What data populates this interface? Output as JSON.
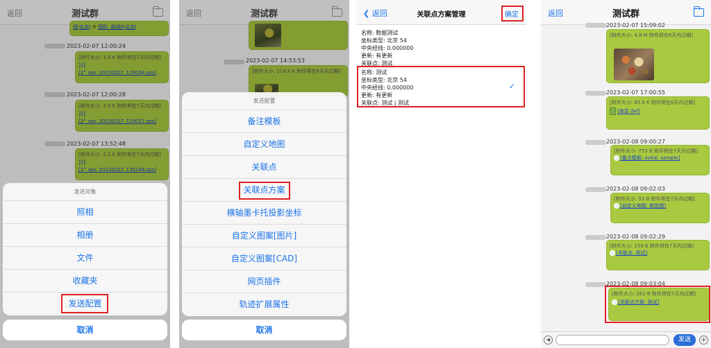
{
  "p1": {
    "nav": {
      "back": "返回",
      "title": "测试群"
    },
    "msg0": {
      "link": "线|北京|"
    },
    "msg0b": {
      "link": "图形: 路线6|北京|"
    },
    "msg1": {
      "time": "2023-02-07 12:00:24",
      "info": "[附件大小: 3.9 K 附件将在7天内过期]",
      "link": "[2°_sps_20230207_120024.sps]"
    },
    "msg2": {
      "time": "2023-02-07 12:00:28",
      "info": "[附件大小: 3.9 K 附件将在7天内过期]",
      "link": "[2°_sps_20230207_120027.sps]"
    },
    "msg3": {
      "time": "2023-02-07 13:52:48",
      "info": "[附件大小: 2.2 K 附件将在7天内过期]",
      "link": "[1°_sps_20230207_135248.sps]"
    },
    "sheet": {
      "header": "发送对象",
      "items": [
        "照相",
        "相册",
        "文件",
        "收藏夹",
        "发送配置"
      ],
      "cancel": "取消"
    }
  },
  "p2": {
    "nav": {
      "back": "返回",
      "title": "测试群"
    },
    "msg1": {
      "time": "2023-02-07 14:53:53",
      "info": "[附件大小: 214.8 K 附件将在6天内过期]"
    },
    "sheet": {
      "header": "发送配置",
      "items": [
        "备注模板",
        "自定义地图",
        "关联点",
        "关联点方案",
        "横轴墨卡托投影坐标",
        "自定义图案[图片]",
        "自定义图案[CAD]",
        "网页插件",
        "轨迹扩展属性"
      ],
      "cancel": "取消"
    }
  },
  "p3": {
    "nav": {
      "back": "返回",
      "title": "关联点方案管理",
      "confirm": "确定"
    },
    "scheme1": [
      "名称: 数据测试",
      "坐标类型: 北京 54",
      "中央经线: 0.000000",
      "更新: 有更新",
      "关联点: 测试"
    ],
    "scheme2": [
      "名称: 测试",
      "坐标类型: 北京 54",
      "中央经线: 0.000000",
      "更新: 有更新",
      "关联点: 测试 | 测试"
    ],
    "check": "✓"
  },
  "p4": {
    "nav": {
      "back": "返回",
      "title": "测试群"
    },
    "msg1": {
      "time": "2023-02-07 15:09:02",
      "info": "[附件大小: 4.8 M 附件将在6天内过期]"
    },
    "msg2": {
      "time": "2023-02-07 17:00:55",
      "info": "[附件大小: 65.8 K 附件将在6天内过期]",
      "link": "[故宫.dxf]"
    },
    "msg3": {
      "time": "2023-02-08 09:00:27",
      "info": "[附件大小: 755 B 附件将在7天内过期]",
      "link": "[备注模板: ovital_sample]"
    },
    "msg4": {
      "time": "2023-02-08 09:02:03",
      "info": "[附件大小: 53 B 附件将在7天内过期]",
      "link": "[自定义地图: 航拍图]"
    },
    "msg5": {
      "time": "2023-02-08 09:02:29",
      "info": "[附件大小: 159 B 附件将在7天内过期]",
      "link": "[关联点: 测试]"
    },
    "msg6": {
      "time": "2023-02-08 09:03:04",
      "info": "[附件大小: 262 B 附件将在7天内过期]",
      "link": "[关联点方案: 测试]"
    },
    "send": "发送"
  }
}
